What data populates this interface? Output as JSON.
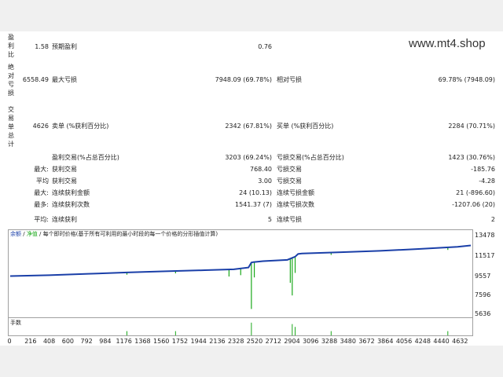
{
  "watermark": "www.mt4.shop",
  "vlabels": [
    "盈利比",
    "绝对亏损",
    "交易单总计"
  ],
  "rows": [
    {
      "left_val": "1.58",
      "left_label": "预期盈利",
      "mid_val": "0.76",
      "right_label": "",
      "right_val": ""
    },
    {
      "left_val": "6558.49",
      "left_label": "最大亏损",
      "mid_val": "7948.09 (69.78%)",
      "right_label": "相对亏损",
      "right_val": "69.78% (7948.09)"
    },
    {
      "left_val": "4626",
      "left_label": "卖单 (%获利百分比)",
      "mid_val": "2342 (67.81%)",
      "right_label": "买单 (%获利百分比)",
      "right_val": "2284 (70.71%)"
    },
    {
      "left_val": "",
      "left_label": "盈利交易(%占总百分比)",
      "mid_val": "3203 (69.24%)",
      "right_label": "亏损交易(%占总百分比)",
      "right_val": "1423 (30.76%)"
    },
    {
      "left_val": "最大:",
      "left_label": "获利交易",
      "mid_val": "768.40",
      "right_label": "亏损交易",
      "right_val": "-185.76"
    },
    {
      "left_val": "平均",
      "left_label": "获利交易",
      "mid_val": "3.00",
      "right_label": "亏损交易",
      "right_val": "-4.28"
    },
    {
      "left_val": "最大:",
      "left_label": "连续获利金额",
      "mid_val": "24 (10.13)",
      "right_label": "连续亏损金额",
      "right_val": "21 (-896.60)"
    },
    {
      "left_val": "最多:",
      "left_label": "连续获利次数",
      "mid_val": "1541.37 (7)",
      "right_label": "连续亏损次数",
      "right_val": "-1207.06 (20)"
    },
    {
      "left_val": "平均:",
      "left_label": "连续获利",
      "mid_val": "5",
      "right_label": "连续亏损",
      "right_val": "2"
    }
  ],
  "chart_header": {
    "a": "余额",
    "sep1": " / ",
    "b": "净值",
    "sep2": " / ",
    "c": "每个即时价格(基于所有可利用的最小时段的每一个价格的分形插值计算)"
  },
  "chart_data": {
    "type": "line",
    "series": [
      {
        "name": "余额",
        "color": "#1a3fa8"
      },
      {
        "name": "净值",
        "color": "#1aa81a"
      }
    ],
    "yticks": [
      "13478",
      "11517",
      "9557",
      "7596",
      "5636"
    ],
    "ylim": [
      5636,
      13478
    ],
    "xticks": [
      "0",
      "216",
      "408",
      "600",
      "792",
      "984",
      "1176",
      "1368",
      "1560",
      "1752",
      "1944",
      "2136",
      "2328",
      "2520",
      "2712",
      "2904",
      "3096",
      "3288",
      "3480",
      "3672",
      "3864",
      "4056",
      "4248",
      "4440",
      "4632"
    ],
    "xlim": [
      0,
      4736
    ],
    "balance_points": [
      [
        0,
        9950
      ],
      [
        400,
        10050
      ],
      [
        800,
        10200
      ],
      [
        1200,
        10350
      ],
      [
        1600,
        10480
      ],
      [
        2000,
        10600
      ],
      [
        2300,
        10700
      ],
      [
        2450,
        10900
      ],
      [
        2480,
        11450
      ],
      [
        2500,
        11500
      ],
      [
        2600,
        11600
      ],
      [
        2850,
        11750
      ],
      [
        2930,
        12100
      ],
      [
        2960,
        12400
      ],
      [
        3000,
        12450
      ],
      [
        3400,
        12600
      ],
      [
        3800,
        12750
      ],
      [
        4200,
        12950
      ],
      [
        4600,
        13200
      ],
      [
        4736,
        13350
      ]
    ],
    "equity_dips": [
      [
        2250,
        9900
      ],
      [
        2370,
        10050
      ],
      [
        2480,
        6300
      ],
      [
        2510,
        9800
      ],
      [
        2880,
        9200
      ],
      [
        2900,
        7800
      ],
      [
        2930,
        10300
      ],
      [
        1200,
        10100
      ],
      [
        1700,
        10250
      ],
      [
        3300,
        12300
      ],
      [
        4500,
        12850
      ]
    ],
    "volume_label": "手数",
    "volume_spikes": [
      [
        1200,
        0.3
      ],
      [
        1700,
        0.3
      ],
      [
        2480,
        0.9
      ],
      [
        2900,
        0.8
      ],
      [
        2930,
        0.6
      ],
      [
        3300,
        0.3
      ],
      [
        4500,
        0.3
      ]
    ]
  }
}
